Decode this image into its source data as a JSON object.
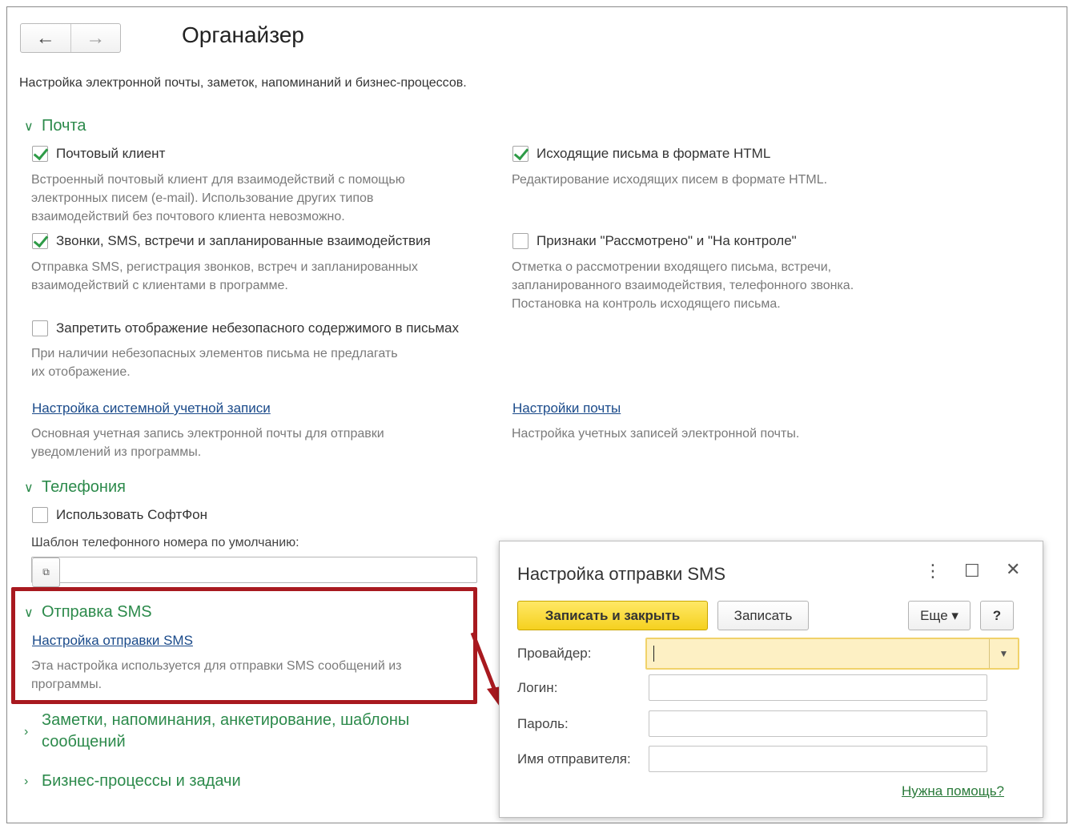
{
  "header": {
    "back_icon": "arrow-left-icon",
    "forward_icon": "arrow-right-icon",
    "title": "Органайзер",
    "subtitle": "Настройка электронной почты, заметок, напоминаний и бизнес-процессов."
  },
  "mail": {
    "title": "Почта",
    "mail_client": {
      "label": "Почтовый клиент",
      "checked": true,
      "desc1": "Встроенный почтовый клиент для взаимодействий с помощью",
      "desc2": "электронных писем (e-mail). Использование других типов",
      "desc3": "взаимодействий без почтового клиента невозможно."
    },
    "html_letters": {
      "label": "Исходящие письма в формате HTML",
      "checked": true,
      "desc": "Редактирование исходящих писем в формате HTML."
    },
    "calls": {
      "label": "Звонки, SMS, встречи и запланированные взаимодействия",
      "checked": true,
      "desc1": "Отправка SMS, регистрация звонков, встреч и запланированных",
      "desc2": "взаимодействий с клиентами в программе."
    },
    "flags": {
      "label": "Признаки \"Рассмотрено\" и \"На контроле\"",
      "checked": false,
      "desc1": "Отметка о рассмотрении входящего письма, встречи,",
      "desc2": "запланированного взаимодействия, телефонного звонка.",
      "desc3": "Постановка на контроль исходящего письма."
    },
    "unsafe": {
      "label": "Запретить отображение небезопасного содержимого в письмах",
      "checked": false,
      "desc1": "При наличии небезопасных элементов письма не предлагать",
      "desc2": "их отображение."
    },
    "system_account": {
      "link": "Настройка системной учетной записи",
      "desc1": "Основная учетная запись электронной почты для отправки",
      "desc2": "уведомлений из программы."
    },
    "mail_settings": {
      "link": "Настройки почты",
      "desc": "Настройка учетных записей электронной почты."
    }
  },
  "telephony": {
    "title": "Телефония",
    "softphone": {
      "label": "Использовать СофтФон",
      "checked": false
    },
    "template_label": "Шаблон телефонного номера по умолчанию:",
    "template_value": ""
  },
  "sms": {
    "title": "Отправка SMS",
    "link": "Настройка отправки SMS",
    "desc1": "Эта настройка используется для отправки SMS сообщений из",
    "desc2": "программы."
  },
  "notes": {
    "line1": "Заметки, напоминания, анкетирование, шаблоны",
    "line2": "сообщений"
  },
  "bp": {
    "title": "Бизнес-процессы и задачи"
  },
  "dialog": {
    "title": "Настройка отправки SMS",
    "save_close": "Записать и закрыть",
    "save": "Записать",
    "more": "Еще ▾",
    "help_btn": "?",
    "provider_label": "Провайдер:",
    "provider_value": "",
    "login_label": "Логин:",
    "login_value": "",
    "password_label": "Пароль:",
    "password_value": "",
    "sender_label": "Имя отправителя:",
    "sender_value": "",
    "help_link": "Нужна помощь?"
  },
  "colors": {
    "accent": "#2c8a4b",
    "link": "#1a4a8a",
    "highlight": "#a8191f",
    "primary_button": "#f5d11f"
  }
}
